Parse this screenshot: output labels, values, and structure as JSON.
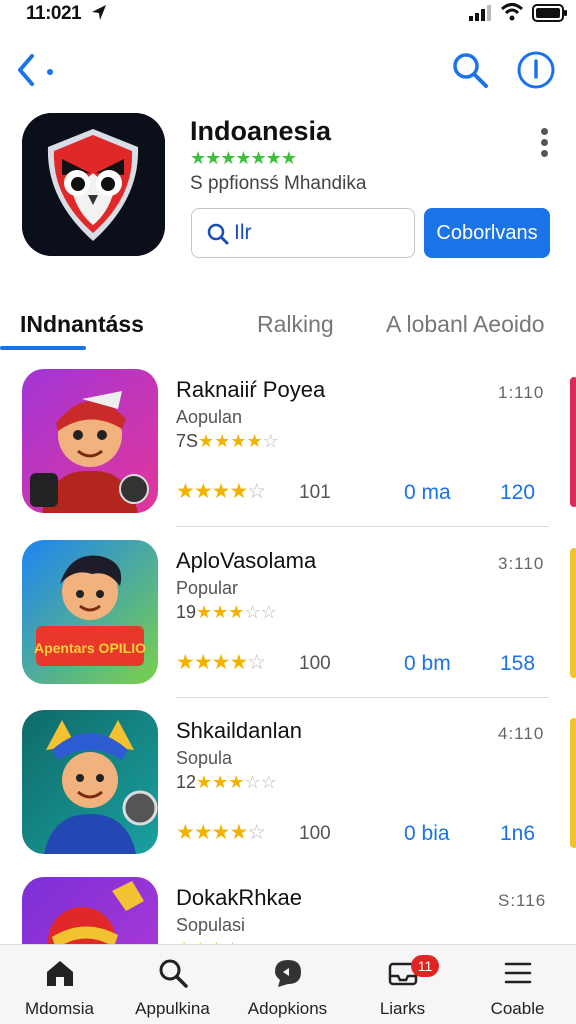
{
  "status_bar": {
    "time": "11:021"
  },
  "header": {
    "app_title": "Indoanesia",
    "stars": "★★★★★★★",
    "subtitle": "S ppfionsś Mhandika",
    "input_text": "Ilr",
    "primary_button": "Coborlvans"
  },
  "tabs": [
    {
      "label": "INdnantáss",
      "active": true
    },
    {
      "label": "Ralking",
      "active": false
    },
    {
      "label": "A lobanl Aeoido",
      "active": false
    }
  ],
  "list": [
    {
      "title": "Raknaiiŕ Poyea",
      "category": "Aopulan",
      "rating_prefix": "7S",
      "rank": "1:110",
      "count": "101",
      "size": "0 ma",
      "number": "120"
    },
    {
      "title": "AploVasolama",
      "category": "Popular",
      "rating_prefix": "19",
      "rank": "3:110",
      "count": "100",
      "size": "0 bm",
      "number": "158"
    },
    {
      "title": "Shkaildanlan",
      "category": "Sopula",
      "rating_prefix": "12",
      "rank": "4:110",
      "count": "100",
      "size": "0 bia",
      "number": "1n6"
    },
    {
      "title": "DokakRhkae",
      "category": "Sopulasi",
      "rating_prefix": "",
      "rank": "S:116",
      "count": "",
      "size": "",
      "number": ""
    }
  ],
  "thumb_text": {
    "item2": "Apentars OPILIO"
  },
  "bottom_nav": [
    {
      "label": "Mdomsia",
      "icon": "home-icon"
    },
    {
      "label": "Appulkina",
      "icon": "search-icon"
    },
    {
      "label": "Adopkions",
      "icon": "chat-icon"
    },
    {
      "label": "Liarks",
      "icon": "inbox-icon",
      "badge": "11"
    },
    {
      "label": "Coable",
      "icon": "menu-icon"
    }
  ],
  "colors": {
    "accent": "#1a73e8",
    "star": "#f2b300",
    "green_star": "#3fbf3f",
    "badge": "#e02424"
  }
}
